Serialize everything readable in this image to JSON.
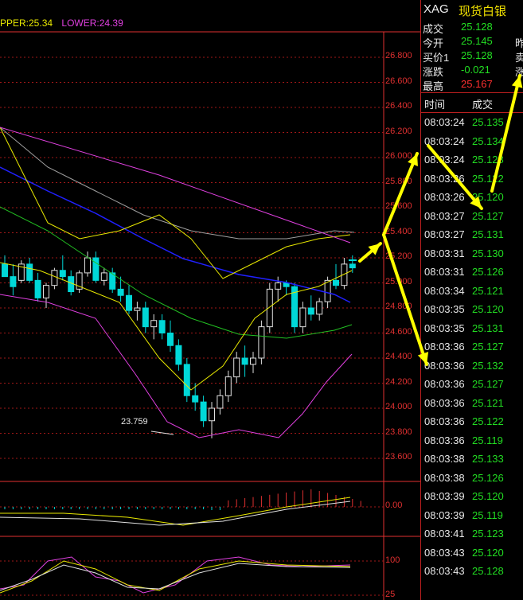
{
  "legend": {
    "upper": "PPER:25.34",
    "lower": "LOWER:24.39"
  },
  "price_axis": [
    "26.800",
    "26.600",
    "26.400",
    "26.200",
    "26.000",
    "25.800",
    "25.600",
    "25.400",
    "25.200",
    "25.000",
    "24.800",
    "24.600",
    "24.400",
    "24.200",
    "24.000",
    "23.800",
    "23.600"
  ],
  "low_marker": "23.759",
  "macd_axis": "0.00",
  "kdj_axis": {
    "top": "100",
    "bottom": "25"
  },
  "colors": {
    "up": "#e8e800",
    "lower": "#e040e0",
    "axis": "#e03030",
    "grid": "#a01818",
    "candle_up": "#e0e0e0",
    "candle_down": "#00d8d8",
    "tick_price": "#22dd22",
    "arrow": "#ffff00"
  },
  "quote": {
    "symbol": "XAG",
    "name": "现货白银",
    "rows": [
      {
        "label": "成交",
        "value": "25.128",
        "color": "#22dd22",
        "right": ""
      },
      {
        "label": "今开",
        "value": "25.145",
        "color": "#22dd22",
        "right": "昨"
      },
      {
        "label": "买价1",
        "value": "25.128",
        "color": "#22dd22",
        "right": "卖"
      },
      {
        "label": "涨跌",
        "value": "-0.021",
        "color": "#22dd22",
        "right": "涨"
      },
      {
        "label": "最高",
        "value": "25.167",
        "color": "#ff3030",
        "right": ""
      }
    ],
    "tick_header": {
      "time": "时间",
      "price": "成交"
    },
    "ticks": [
      {
        "time": "08:03:24",
        "price": "25.135"
      },
      {
        "time": "08:03:24",
        "price": "25.134"
      },
      {
        "time": "08:03:24",
        "price": "25.128"
      },
      {
        "time": "08:03:26",
        "price": "25.122"
      },
      {
        "time": "08:03:26",
        "price": "25.120"
      },
      {
        "time": "08:03:27",
        "price": "25.127"
      },
      {
        "time": "08:03:27",
        "price": "25.131"
      },
      {
        "time": "08:03:31",
        "price": "25.130"
      },
      {
        "time": "08:03:31",
        "price": "25.126"
      },
      {
        "time": "08:03:34",
        "price": "25.121"
      },
      {
        "time": "08:03:35",
        "price": "25.120"
      },
      {
        "time": "08:03:35",
        "price": "25.131"
      },
      {
        "time": "08:03:36",
        "price": "25.127"
      },
      {
        "time": "08:03:36",
        "price": "25.132"
      },
      {
        "time": "08:03:36",
        "price": "25.127"
      },
      {
        "time": "08:03:36",
        "price": "25.121"
      },
      {
        "time": "08:03:36",
        "price": "25.122"
      },
      {
        "time": "08:03:36",
        "price": "25.119"
      },
      {
        "time": "08:03:38",
        "price": "25.133"
      },
      {
        "time": "08:03:38",
        "price": "25.126"
      },
      {
        "time": "08:03:39",
        "price": "25.120"
      },
      {
        "time": "08:03:39",
        "price": "25.119"
      },
      {
        "time": "08:03:41",
        "price": "25.123"
      },
      {
        "time": "08:03:43",
        "price": "25.120"
      },
      {
        "time": "08:03:43",
        "price": "25.128"
      }
    ]
  }
}
